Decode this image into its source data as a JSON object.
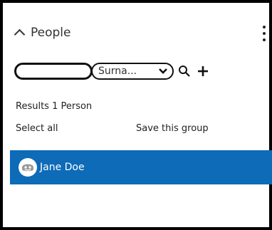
{
  "panel": {
    "title": "People",
    "menu_icon": "kebab-menu-icon",
    "collapse_icon": "chevron-up-icon"
  },
  "search": {
    "value": "",
    "placeholder": ""
  },
  "sort_select": {
    "selected": "Surna..."
  },
  "icons": {
    "search": "search-icon",
    "add": "plus-icon"
  },
  "results": {
    "text": "Results 1 Person"
  },
  "actions": {
    "select_all": "Select all",
    "save_group": "Save this group"
  },
  "people": [
    {
      "name": "Jane Doe",
      "selected": true
    }
  ],
  "colors": {
    "selected_row": "#0d6bb8",
    "frame": "#000000"
  }
}
